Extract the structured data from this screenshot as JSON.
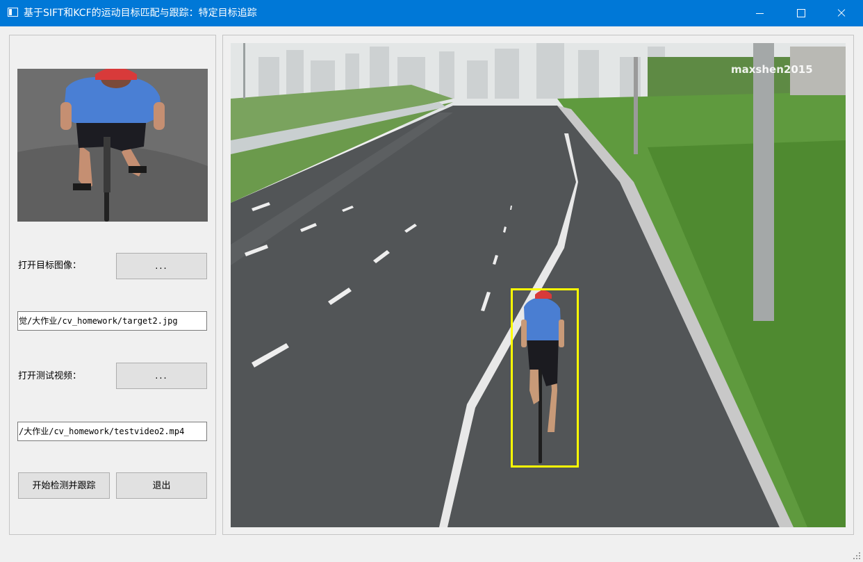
{
  "window": {
    "title": "基于SIFT和KCF的运动目标匹配与跟踪：特定目标追踪",
    "icon": "app-window-icon"
  },
  "controls": {
    "open_target_label": "打开目标图像：",
    "open_target_button": "...",
    "target_path": "觉/大作业/cv_homework/target2.jpg",
    "open_video_label": "打开测试视频：",
    "open_video_button": "...",
    "video_path": "/大作业/cv_homework/testvideo2.mp4",
    "start_button": "开始检测并跟踪",
    "exit_button": "退出"
  },
  "video": {
    "watermark": "maxshen2015",
    "tracking_box_color": "#ffff00"
  },
  "colors": {
    "titlebar": "#0078d7",
    "window_bg": "#f0f0f0"
  }
}
